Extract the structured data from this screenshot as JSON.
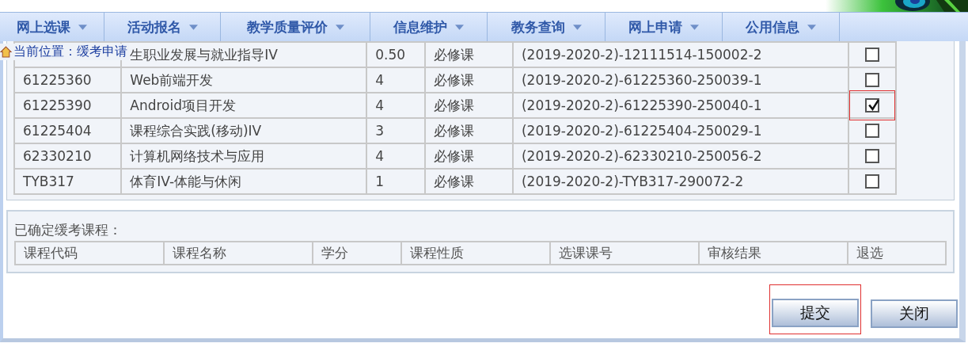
{
  "nav": [
    {
      "label": "网上选课"
    },
    {
      "label": "活动报名"
    },
    {
      "label": "教学质量评价"
    },
    {
      "label": "信息维护"
    },
    {
      "label": "教务查询"
    },
    {
      "label": "网上申请"
    },
    {
      "label": "公用信息"
    }
  ],
  "breadcrumb": "当前位置：缓考申请",
  "courses": [
    {
      "name": "生职业发展与就业指导IV",
      "credit": "0.50",
      "type": "必修课",
      "number": "(2019-2020-2)-12111514-150002-2",
      "checked": false,
      "highlighted": false
    },
    {
      "code": "61225360",
      "name": "Web前端开发",
      "credit": "4",
      "type": "必修课",
      "number": "(2019-2020-2)-61225360-250039-1",
      "checked": false,
      "highlighted": false
    },
    {
      "code": "61225390",
      "name": "Android项目开发",
      "credit": "4",
      "type": "必修课",
      "number": "(2019-2020-2)-61225390-250040-1",
      "checked": true,
      "highlighted": true
    },
    {
      "code": "61225404",
      "name": "课程综合实践(移动)IV",
      "credit": "3",
      "type": "必修课",
      "number": "(2019-2020-2)-61225404-250029-1",
      "checked": false,
      "highlighted": false
    },
    {
      "code": "62330210",
      "name": "计算机网络技术与应用",
      "credit": "4",
      "type": "必修课",
      "number": "(2019-2020-2)-62330210-250056-2",
      "checked": false,
      "highlighted": false
    },
    {
      "code": "TYB317",
      "name": "体育IV-体能与休闲",
      "credit": "1",
      "type": "必修课",
      "number": "(2019-2020-2)-TYB317-290072-2",
      "checked": false,
      "highlighted": false
    }
  ],
  "confirmed": {
    "title": "已确定缓考课程：",
    "columns": [
      "课程代码",
      "课程名称",
      "学分",
      "课程性质",
      "选课课号",
      "审核结果",
      "退选"
    ]
  },
  "buttons": [
    {
      "label": "提交",
      "highlighted": true
    },
    {
      "label": "关闭",
      "highlighted": false
    }
  ]
}
